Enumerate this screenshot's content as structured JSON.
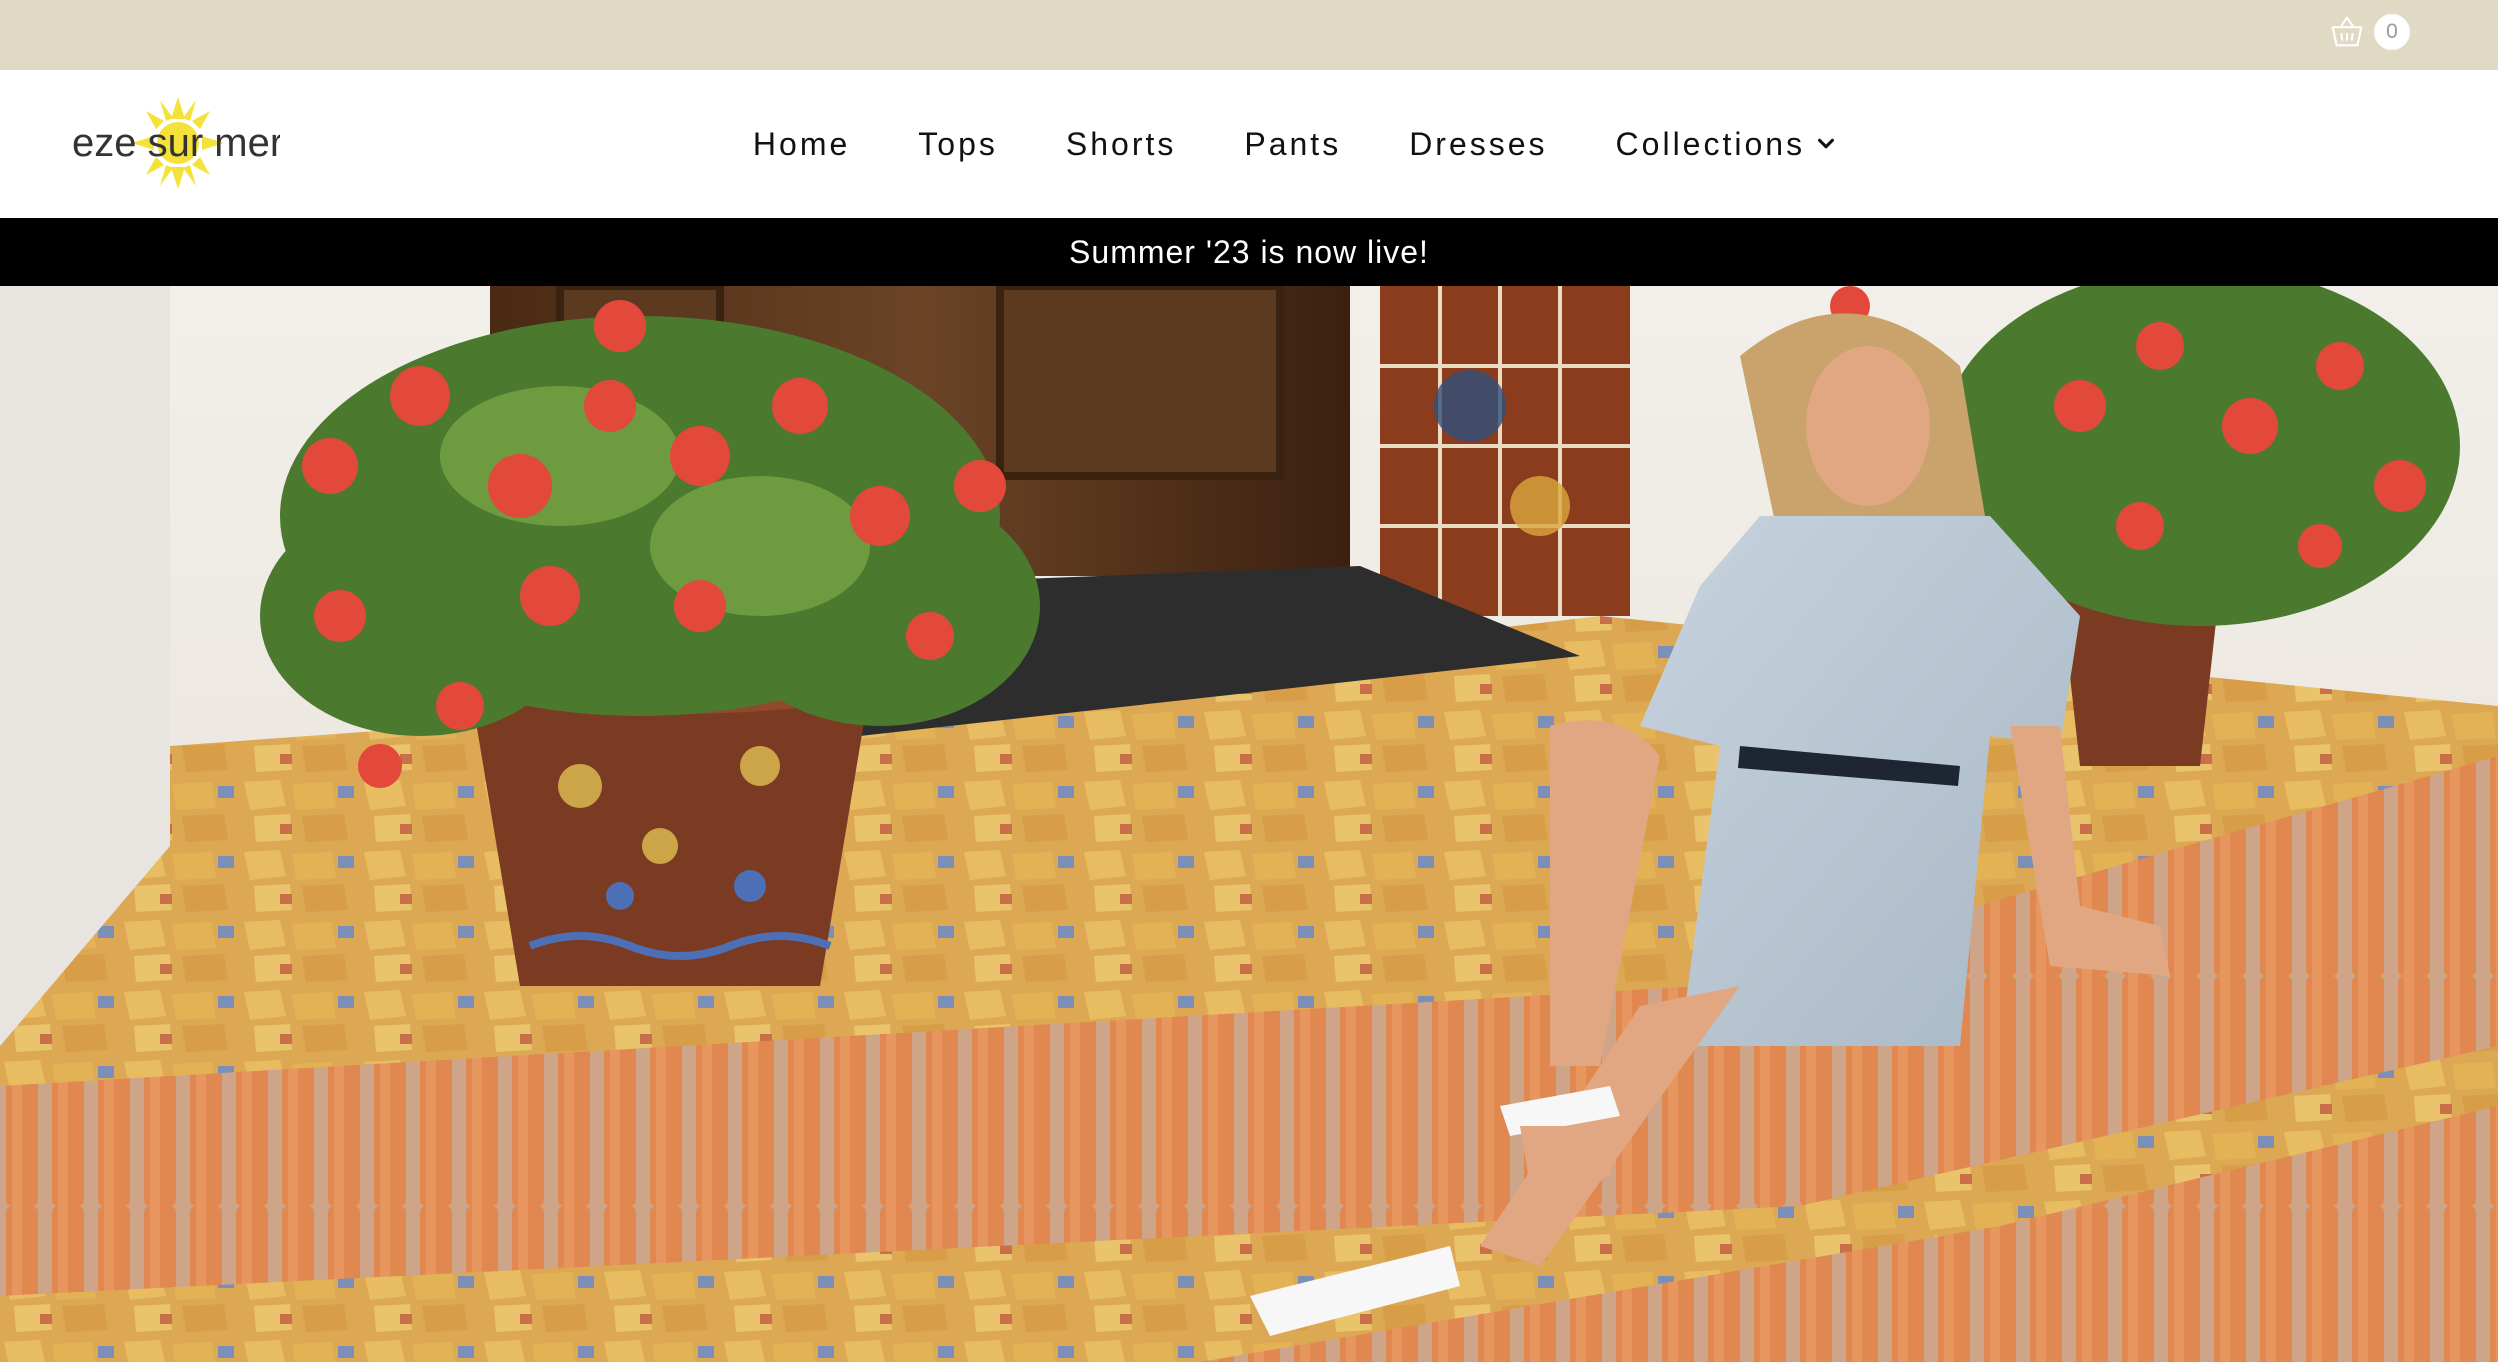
{
  "topbar": {
    "background": "#e0dac5"
  },
  "cart": {
    "icon": "shopping-basket-icon",
    "count": "0"
  },
  "logo": {
    "text": "eze sur mer",
    "sun_color": "#f4e23a"
  },
  "nav": {
    "items": [
      {
        "label": "Home"
      },
      {
        "label": "Tops"
      },
      {
        "label": "Shorts"
      },
      {
        "label": "Pants"
      },
      {
        "label": "Dresses"
      },
      {
        "label": "Collections",
        "has_dropdown": true,
        "icon": "chevron-down-icon"
      }
    ]
  },
  "announcement": {
    "text": "Summer '23 is now live!"
  },
  "hero": {
    "image": "woman-in-shirt-dress-sitting-on-brick-steps-with-geraniums"
  }
}
